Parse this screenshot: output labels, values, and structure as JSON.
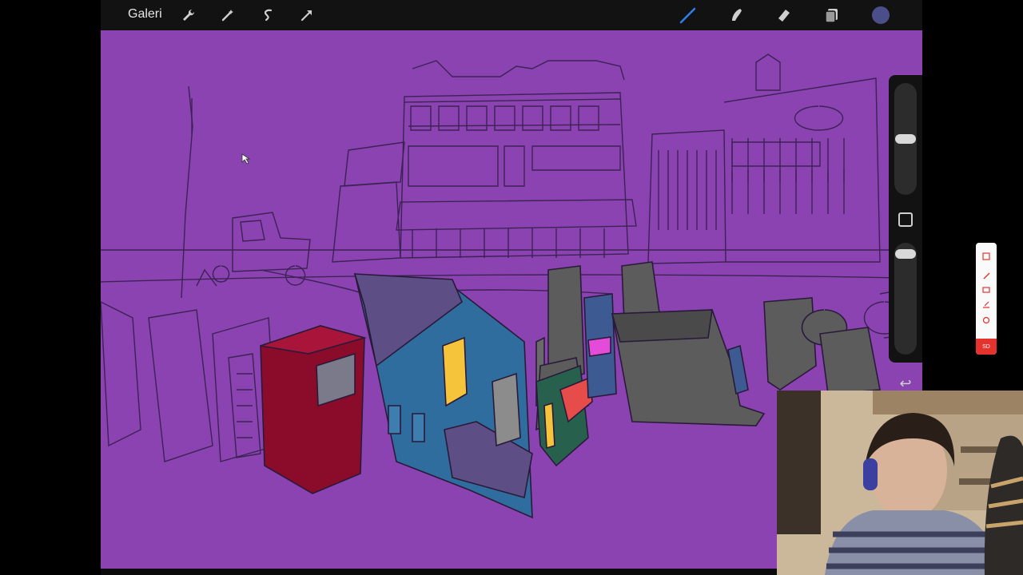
{
  "toolbar": {
    "gallery_label": "Galeri",
    "left_tools": [
      "wrench-icon",
      "magic-wand-icon",
      "selection-icon",
      "transform-arrow-icon"
    ],
    "right_tools": [
      "brush-icon",
      "smudge-icon",
      "eraser-icon",
      "layers-icon",
      "color-swatch"
    ],
    "active_color": "#4a4f8a",
    "brush_color": "#2f7ee6"
  },
  "canvas": {
    "background": "#8a43b0",
    "line_color": "#3c2255"
  },
  "floating_bar": {
    "record_label": "SD"
  },
  "colors": {
    "red_building": "#8a0b2a",
    "blue_building": "#2f6d9e",
    "dark_building": "#5d4f86",
    "gray_block": "#5c5c5c",
    "yellow_window": "#f5c43a",
    "green_panel": "#27614d",
    "pink_screen": "#e44bd8",
    "coral_sign": "#e54c4a"
  }
}
